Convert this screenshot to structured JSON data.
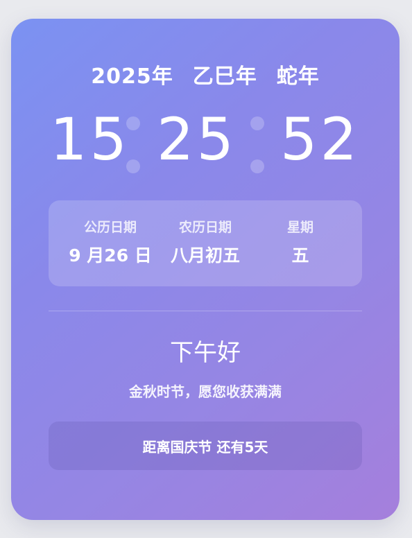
{
  "header": {
    "year": "2025年",
    "ganzhi": "乙巳年",
    "zodiac": "蛇年"
  },
  "clock": {
    "hours": "15",
    "minutes": "25",
    "seconds": "52"
  },
  "date_panel": {
    "solar": {
      "label": "公历日期",
      "value": "9 月26 日"
    },
    "lunar": {
      "label": "农历日期",
      "value": "八月初五"
    },
    "weekday": {
      "label": "星期",
      "value": "五"
    }
  },
  "greeting": "下午好",
  "subtext": "金秋时节，愿您收获满满",
  "countdown": "距离国庆节 还有5天",
  "colors": {
    "gradient_start": "#7b92f2",
    "gradient_end": "#a57fdc",
    "text": "#ffffff"
  }
}
